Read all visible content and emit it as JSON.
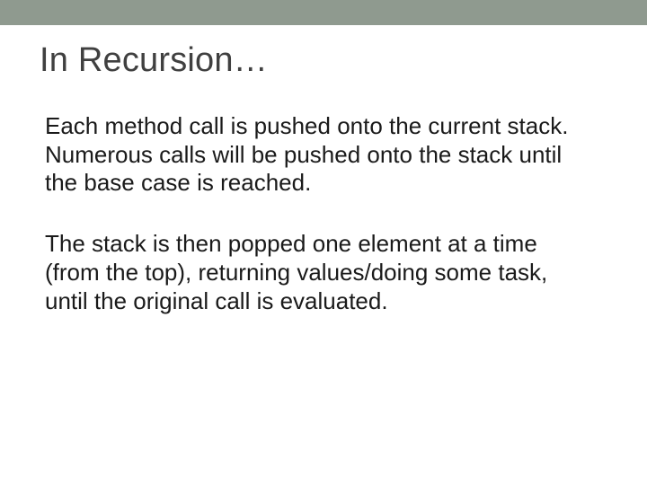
{
  "slide": {
    "title": "In Recursion…",
    "paragraph1": "Each method call is pushed onto the current stack. Numerous calls will be pushed onto the stack until the base case is reached.",
    "paragraph2": "The stack is then popped one element at a time (from the top), returning values/doing some task, until the original call is evaluated."
  }
}
